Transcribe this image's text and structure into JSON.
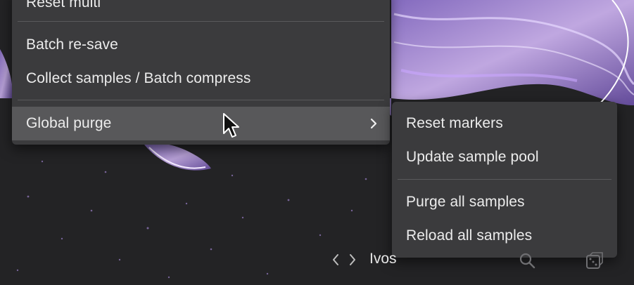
{
  "main_menu": {
    "items": [
      {
        "label": "Reset multi"
      },
      {
        "label": "Batch re-save"
      },
      {
        "label": "Collect samples / Batch compress"
      },
      {
        "label": "Global purge"
      }
    ]
  },
  "submenu": {
    "items": [
      {
        "label": "Reset markers"
      },
      {
        "label": "Update sample pool"
      },
      {
        "label": "Purge all samples"
      },
      {
        "label": "Reload all samples"
      }
    ]
  },
  "toolbar": {
    "folder_name": "Ivos",
    "icons": [
      "chevron-left-icon",
      "chevron-right-icon",
      "search-icon",
      "dice-icon"
    ]
  },
  "colors": {
    "menu_bg": "#3b3b3d",
    "menu_active_bg": "#58585a",
    "text": "#ececec",
    "artwork_accent": "#b79be8"
  }
}
